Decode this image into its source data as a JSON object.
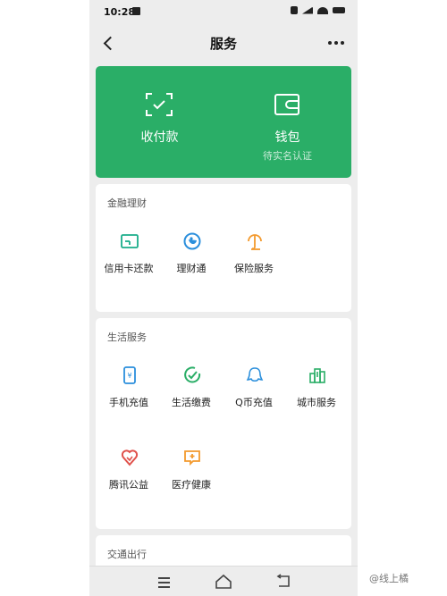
{
  "status": {
    "time": "10:28"
  },
  "nav": {
    "title": "服务"
  },
  "pay": {
    "left_label": "收付款",
    "right_label": "钱包",
    "right_sub": "待实名认证"
  },
  "finance": {
    "title": "金融理财",
    "items": [
      {
        "label": "信用卡还款",
        "icon": "credit-card-icon",
        "color": "#1aad8a"
      },
      {
        "label": "理财通",
        "icon": "wealth-icon",
        "color": "#2b8fdc"
      },
      {
        "label": "保险服务",
        "icon": "insurance-icon",
        "color": "#f39a2e"
      }
    ]
  },
  "life": {
    "title": "生活服务",
    "items": [
      {
        "label": "手机充值",
        "icon": "phone-icon",
        "color": "#2b8fdc"
      },
      {
        "label": "生活缴费",
        "icon": "check-icon",
        "color": "#2aae67"
      },
      {
        "label": "Q币充值",
        "icon": "qq-icon",
        "color": "#2b8fdc"
      },
      {
        "label": "城市服务",
        "icon": "city-icon",
        "color": "#2aae67"
      },
      {
        "label": "腾讯公益",
        "icon": "heart-icon",
        "color": "#e0514b"
      },
      {
        "label": "医疗健康",
        "icon": "medical-icon",
        "color": "#f39a2e"
      }
    ]
  },
  "transport": {
    "title": "交通出行"
  },
  "watermark": "@线上橘"
}
